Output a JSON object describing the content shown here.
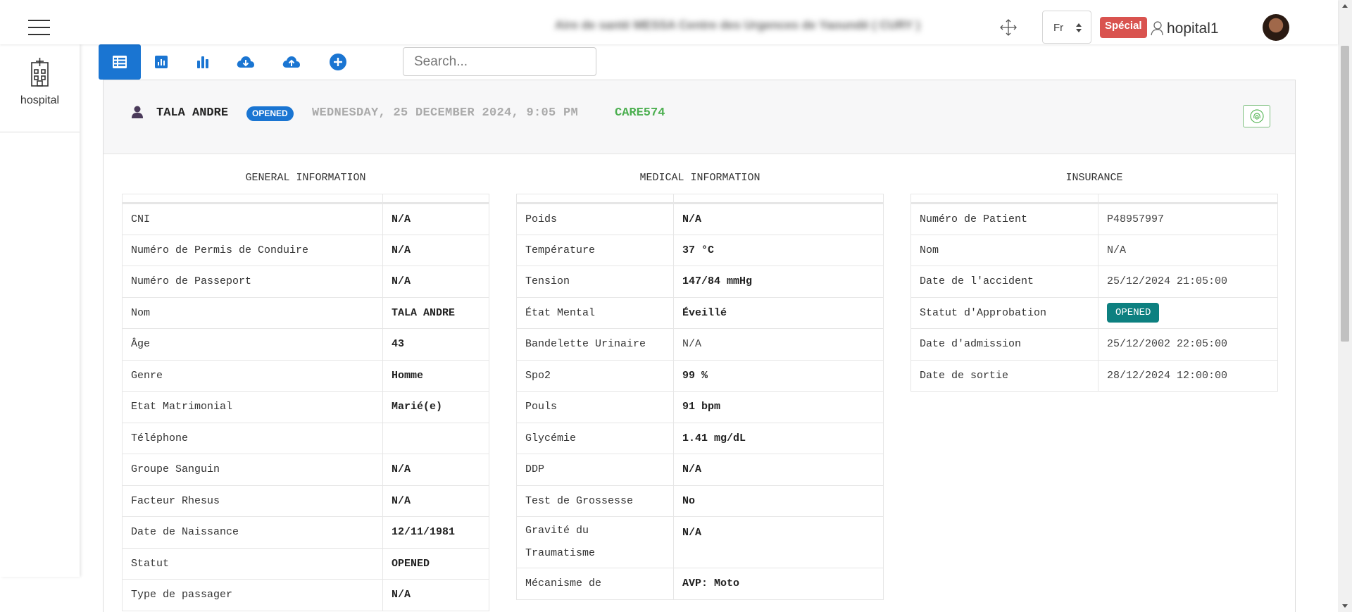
{
  "topbar": {
    "facility_name": "Aire de santé MESSA Centre des Urgences de Yaoundé ( CURY )",
    "language": "Fr",
    "special_badge": "Spécial",
    "username": "hopital1"
  },
  "sidebar": {
    "items": [
      {
        "label": "hospital",
        "icon": "hospital-icon"
      }
    ]
  },
  "toolbar": {
    "buttons": [
      "table-view-icon",
      "chart-box-icon",
      "bar-chart-icon",
      "cloud-download-icon",
      "cloud-upload-icon",
      "add-circle-icon"
    ],
    "search_placeholder": "Search..."
  },
  "patient": {
    "name": "TALA ANDRE",
    "status": "OPENED",
    "datetime": "WEDNESDAY, 25 DECEMBER 2024, 9:05 PM",
    "care_code": "CARE574"
  },
  "general": {
    "title": "GENERAL INFORMATION",
    "rows": [
      {
        "label": "CNI",
        "value": "N/A"
      },
      {
        "label": "Numéro de Permis de Conduire",
        "value": "N/A"
      },
      {
        "label": "Numéro de Passeport",
        "value": "N/A"
      },
      {
        "label": "Nom",
        "value": "TALA ANDRE"
      },
      {
        "label": "Âge",
        "value": "43"
      },
      {
        "label": "Genre",
        "value": "Homme"
      },
      {
        "label": "Etat Matrimonial",
        "value": "Marié(e)"
      },
      {
        "label": "Téléphone",
        "value": ""
      },
      {
        "label": "Groupe Sanguin",
        "value": "N/A"
      },
      {
        "label": "Facteur Rhesus",
        "value": "N/A"
      },
      {
        "label": "Date de Naissance",
        "value": "12/11/1981"
      },
      {
        "label": "Statut",
        "value": "OPENED"
      },
      {
        "label": "Type de passager",
        "value": "N/A"
      }
    ]
  },
  "medical": {
    "title": "MEDICAL INFORMATION",
    "rows": [
      {
        "label": "Poids",
        "value": "N/A"
      },
      {
        "label": "Température",
        "value": "37 °C"
      },
      {
        "label": "Tension",
        "value": "147/84 mmHg"
      },
      {
        "label": "État Mental",
        "value": "Éveillé"
      },
      {
        "label": "Bandelette Urinaire",
        "value": "N/A"
      },
      {
        "label": "Spo2",
        "value": "99 %"
      },
      {
        "label": "Pouls",
        "value": "91 bpm"
      },
      {
        "label": "Glycémie",
        "value": "1.41 mg/dL"
      },
      {
        "label": "DDP",
        "value": "N/A"
      },
      {
        "label": "Test de Grossesse",
        "value": "No"
      },
      {
        "label": "Gravité du Traumatisme",
        "value": "N/A"
      },
      {
        "label": "Mécanisme de",
        "value": "AVP: Moto"
      }
    ]
  },
  "insurance": {
    "title": "INSURANCE",
    "rows": [
      {
        "label": "Numéro de Patient",
        "value": "P48957997"
      },
      {
        "label": "Nom",
        "value": "N/A"
      },
      {
        "label": "Date de l'accident",
        "value": "25/12/2024 21:05:00"
      },
      {
        "label": "Statut d'Approbation",
        "value": "OPENED"
      },
      {
        "label": "Date d'admission",
        "value": "25/12/2002 22:05:00"
      },
      {
        "label": "Date de sortie",
        "value": "28/12/2024 12:00:00"
      }
    ]
  },
  "colors": {
    "primary": "#1a75d2",
    "success_text": "#4caf50",
    "danger": "#d9534f",
    "teal": "#0d8080"
  }
}
